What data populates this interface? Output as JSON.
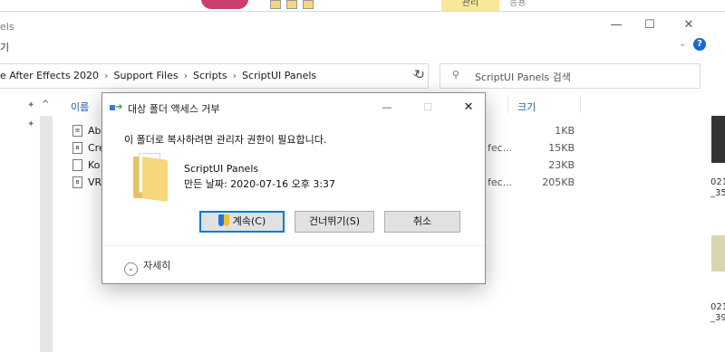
{
  "top_ribbon": {
    "tab_highlight": "관리",
    "tab2": "응용"
  },
  "window": {
    "title_fragment": "els",
    "minimize": "—",
    "maximize": "☐",
    "close": "✕"
  },
  "ribbon": {
    "label_fragment": "기",
    "expand": "⌄",
    "help": "?"
  },
  "address": {
    "crumbs": [
      "e After Effects 2020",
      "Support Files",
      "Scripts",
      "ScriptUI Panels"
    ],
    "separator": "›",
    "dropdown": "⌄",
    "refresh": "↻"
  },
  "search": {
    "placeholder": "ScriptUI Panels 검색",
    "icon": "search-icon"
  },
  "columns": {
    "name": "이름",
    "size": "크기"
  },
  "files": [
    {
      "name": "Ab",
      "type": "",
      "size": "1KB"
    },
    {
      "name": "Cre",
      "type": "fec...",
      "size": "15KB"
    },
    {
      "name": "Ko",
      "type": "",
      "size": "23KB"
    },
    {
      "name": "VR",
      "type": "fec...",
      "size": "205KB"
    }
  ],
  "right_edge": {
    "t1": "021",
    "t2": "_35",
    "t3": "021",
    "t4": "_39"
  },
  "dialog": {
    "title": "대상 폴더 액세스 거부",
    "minimize": "—",
    "maximize": "☐",
    "close": "✕",
    "message": "이 폴더로 복사하려면 관리자 권한이 필요합니다.",
    "folder_name": "ScriptUI Panels",
    "created": "만든 날짜: 2020-07-16 오후 3:37",
    "buttons": {
      "continue": "계속(C)",
      "skip": "건너뛰기(S)",
      "cancel": "취소"
    },
    "more_details": "자세히",
    "colors": {
      "accent": "#0078d7",
      "folder": "#f6d77a"
    }
  }
}
